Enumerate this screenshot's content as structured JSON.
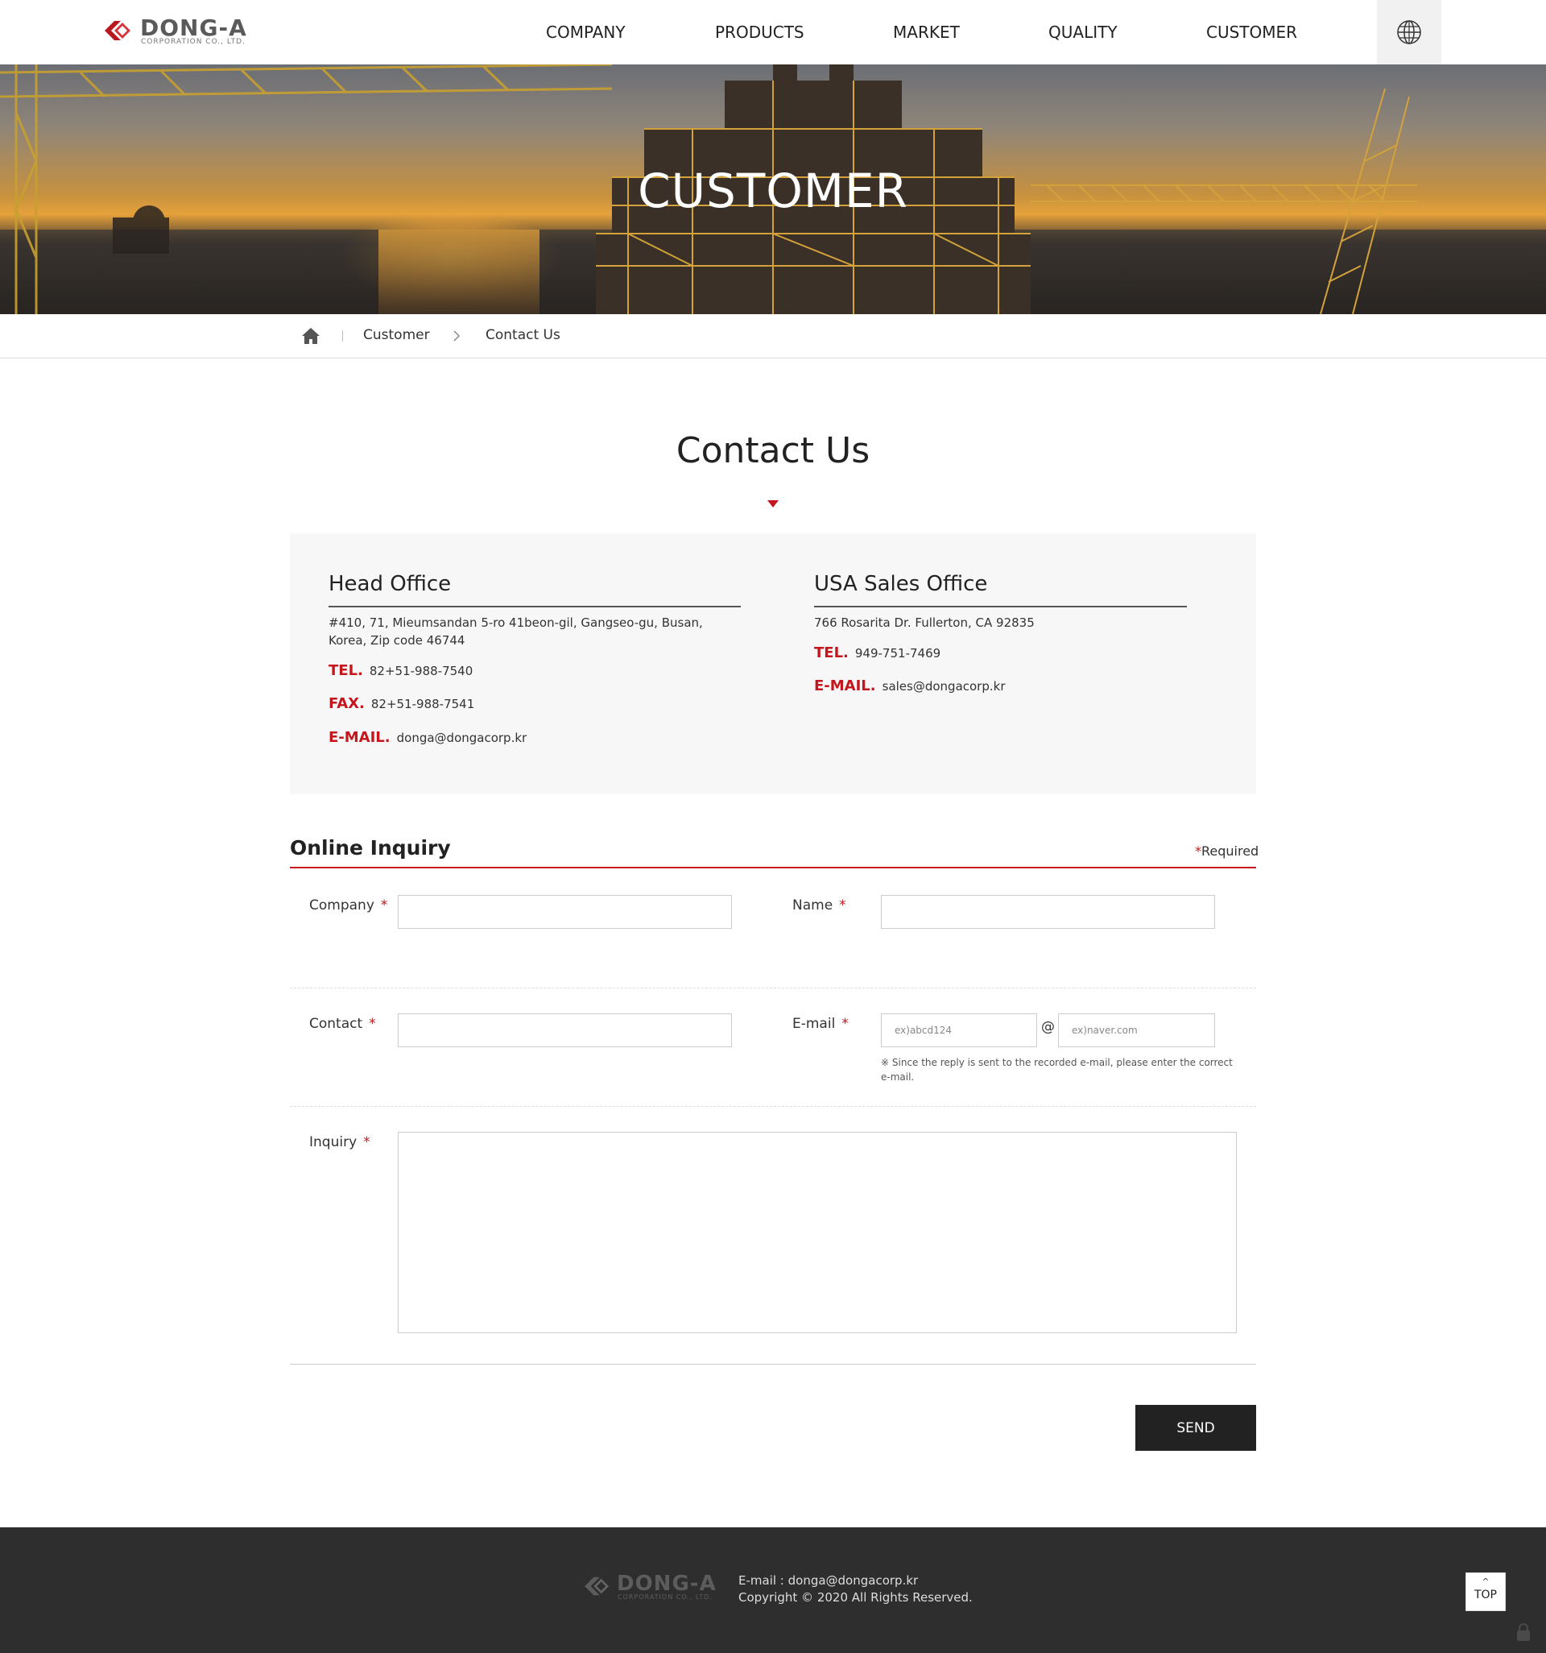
{
  "brand": {
    "logo_main": "DONG-A",
    "logo_sub": "CORPORATION CO., LTD.",
    "accent_color": "#c4161c"
  },
  "nav": {
    "items": [
      "COMPANY",
      "PRODUCTS",
      "MARKET",
      "QUALITY",
      "CUSTOMER"
    ],
    "language_icon": "globe-icon"
  },
  "hero": {
    "title": "CUSTOMER"
  },
  "breadcrumb": {
    "home_icon": "home-icon",
    "items": [
      "Customer",
      "Contact Us"
    ]
  },
  "page": {
    "title": "Contact Us"
  },
  "offices": {
    "head": {
      "name": "Head Office",
      "address_line1": "#410, 71, Mieumsandan 5-ro 41beon-gil, Gangseo-gu, Busan,",
      "address_line2": "Korea, Zip code 46744",
      "tel_label": "TEL.",
      "tel": "82+51-988-7540",
      "fax_label": "FAX.",
      "fax": "82+51-988-7541",
      "email_label": "E-MAIL.",
      "email": "donga@dongacorp.kr"
    },
    "usa": {
      "name": "USA Sales Office",
      "address": "766 Rosarita Dr. Fullerton, CA 92835",
      "tel_label": "TEL.",
      "tel": "949-751-7469",
      "email_label": "E-MAIL.",
      "email": "sales@dongacorp.kr"
    }
  },
  "form": {
    "title": "Online Inquiry",
    "required_star": "*",
    "required_text": "Required",
    "fields": {
      "company": {
        "label": "Company",
        "value": ""
      },
      "name": {
        "label": "Name",
        "value": ""
      },
      "contact": {
        "label": "Contact",
        "value": ""
      },
      "email": {
        "label": "E-mail",
        "user_placeholder": "ex)abcd124",
        "at": "@",
        "domain_placeholder": "ex)naver.com",
        "note_line1": "※ Since the reply is sent to the recorded e-mail, please enter the correct",
        "note_line2": "e-mail."
      },
      "inquiry": {
        "label": "Inquiry",
        "value": ""
      }
    },
    "star": "*",
    "send_label": "SEND"
  },
  "footer": {
    "email": "E-mail : donga@dongacorp.kr",
    "copyright": "Copyright © 2020 All Rights Reserved.",
    "top_chevron": "^",
    "top_label": "TOP",
    "lock_icon": "lock-icon"
  }
}
